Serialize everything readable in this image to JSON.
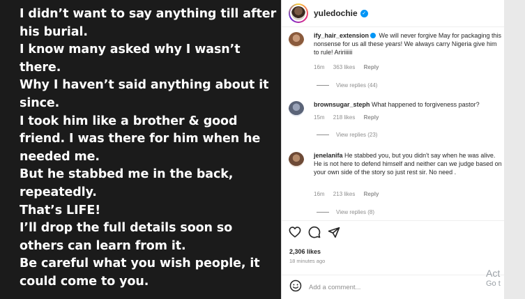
{
  "post_text": {
    "lines": [
      "I didn’t want to say anything till after",
      "his burial.",
      "I know many asked why I wasn’t",
      "there.",
      "Why I haven’t said anything about it",
      "since.",
      "I took him like a brother & good",
      "friend. I was there for him when he",
      "needed me.",
      "But he stabbed me in the back,",
      "repeatedly.",
      "That’s LIFE!",
      "I’ll drop the full details soon so",
      "others can learn from it.",
      "Be careful what you wish people, it",
      "could come to you."
    ]
  },
  "header": {
    "username": "yuledochie",
    "verified": true
  },
  "comments": [
    {
      "handle": "ify_hair_extension",
      "verified": true,
      "text": "We will never forgive May for packaging this nonsense for us all these years! We always carry Nigeria give him to rule! Aririiiiii",
      "time": "16m",
      "likes": "363 likes",
      "reply": "Reply",
      "view_replies": "View replies (44)",
      "avatar_color": "#8a5a3c"
    },
    {
      "handle": "brownsugar_steph",
      "verified": false,
      "text": "What happened to forgiveness pastor?",
      "time": "15m",
      "likes": "218 likes",
      "reply": "Reply",
      "view_replies": "View replies (23)",
      "avatar_color": "#5b6478"
    },
    {
      "handle": "jenelanifa",
      "verified": false,
      "text": "He stabbed you, but you didn't say when he was alive. He is not here to defend himself and neither can we judge based on your own side of the story so just rest sir. No need .",
      "time": "16m",
      "likes": "213 likes",
      "reply": "Reply",
      "view_replies": "View replies (8)",
      "avatar_color": "#6d4a36"
    }
  ],
  "stats": {
    "likes": "2,306 likes",
    "time": "18 minutes ago"
  },
  "comment_input": {
    "placeholder": "Add a comment..."
  },
  "icons": {
    "like": "heart-icon",
    "comment": "comment-icon",
    "share": "share-icon",
    "emoji": "emoji-icon"
  },
  "watermark": {
    "line1": "Act",
    "line2": "Go t"
  },
  "colors": {
    "verified": "#0095f6",
    "post_bg": "#1b1b1b"
  }
}
